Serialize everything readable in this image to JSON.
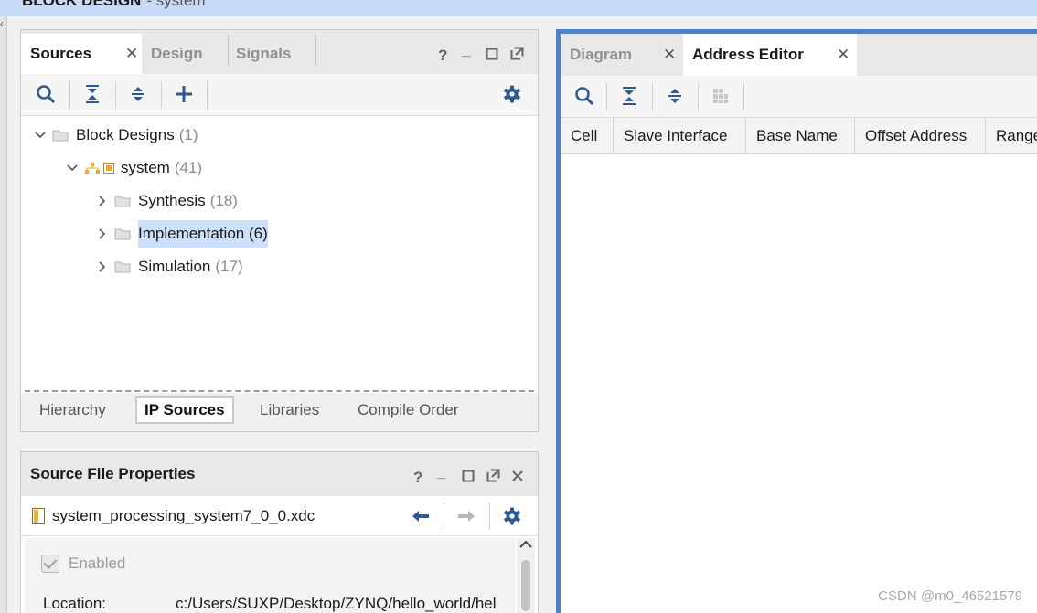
{
  "banner": {
    "title": "BLOCK DESIGN",
    "subtitle": "- system"
  },
  "sources": {
    "tabs": [
      {
        "label": "Sources",
        "active": true
      },
      {
        "label": "Design",
        "active": false
      },
      {
        "label": "Signals",
        "active": false
      }
    ],
    "controls": {
      "help": "?",
      "minimize": "_"
    },
    "tree": {
      "root": {
        "label": "Block Designs",
        "count": "(1)"
      },
      "design": {
        "label": "system",
        "count": "(41)"
      },
      "children": [
        {
          "label": "Synthesis",
          "count": "(18)",
          "selected": false
        },
        {
          "label": "Implementation",
          "count": "(6)",
          "selected": true
        },
        {
          "label": "Simulation",
          "count": "(17)",
          "selected": false
        }
      ]
    },
    "bottom_tabs": [
      {
        "label": "Hierarchy",
        "active": false
      },
      {
        "label": "IP Sources",
        "active": true
      },
      {
        "label": "Libraries",
        "active": false
      },
      {
        "label": "Compile Order",
        "active": false
      }
    ]
  },
  "properties": {
    "title": "Source File Properties",
    "controls": {
      "help": "?",
      "minimize": "_"
    },
    "file_name": "system_processing_system7_0_0.xdc",
    "enabled_label": "Enabled",
    "location_label": "Location:",
    "location_value": "c:/Users/SUXP/Desktop/ZYNQ/hello_world/hel"
  },
  "address_editor": {
    "tabs": [
      {
        "label": "Diagram",
        "active": false
      },
      {
        "label": "Address Editor",
        "active": true
      }
    ],
    "columns": [
      "Cell",
      "Slave Interface",
      "Base Name",
      "Offset Address",
      "Range"
    ]
  },
  "watermark": "CSDN @m0_46521579",
  "colors": {
    "accent_border": "#5180c6",
    "selection": "#cde0fb",
    "icon_blue": "#2f5a8f",
    "banner": "#c6d9f7"
  }
}
